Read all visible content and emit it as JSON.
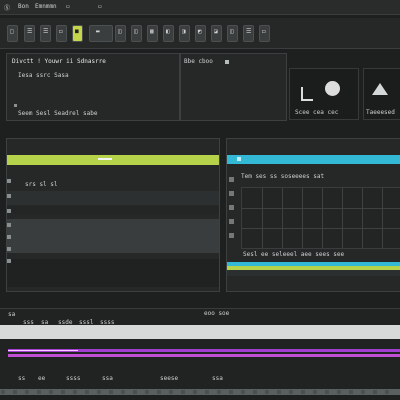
{
  "menubar": {
    "items": [
      "Ⓢ",
      "Bon",
      "Emnmmn"
    ],
    "window_controls": [
      "▭",
      "▭"
    ]
  },
  "toolbar": {
    "buttons": [
      "□",
      "☰",
      "☰",
      "◻",
      "■",
      "▬",
      "◫",
      "◫",
      "▦",
      "◧",
      "◨",
      "◩",
      "◪",
      "◫",
      "☰",
      "◻"
    ]
  },
  "top_panel_left": {
    "title": "Divctt ! Youwr ii Sdnasrre",
    "subtitle": "Iesa ssrc Sasa",
    "footer_text": "Seem Sesl Seadrel sabe"
  },
  "top_panel_mid": {
    "title": "Bbe cboo"
  },
  "top_panel_right": {
    "labels": [
      "Scee cea cec",
      "Taeeesed"
    ]
  },
  "left_editor": {
    "rows": [
      "srs  sl  sl",
      "",
      "",
      ""
    ]
  },
  "right_editor": {
    "header": "Tem ses  ss  soseeees  sat",
    "footer": "Sesl ee seleeel aee  sees see"
  },
  "timeline": {
    "header_items": [
      "sa",
      "sss",
      "sa",
      "ssde",
      "sssl",
      "ssss"
    ],
    "center_label": "eoo soe",
    "footer_labels": [
      "ss",
      "ee",
      "ssss",
      "ssa",
      "seese",
      "ssa"
    ]
  },
  "colors": {
    "lime": "#b6d24a",
    "cyan": "#33b9d6",
    "purple": "#a23fd1",
    "magenta": "#c24fd6"
  }
}
